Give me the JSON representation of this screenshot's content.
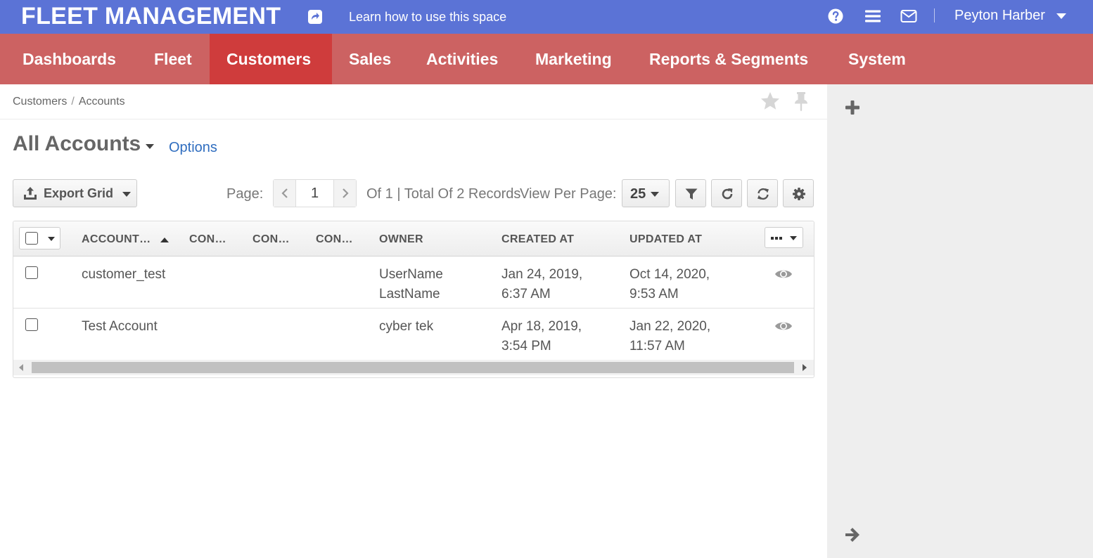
{
  "header": {
    "brand": "FLEET MANAGEMENT",
    "share_icon": "share-square-icon",
    "learn_link": "Learn how to use this space",
    "help_icon": "question-circle-icon",
    "menu_icon": "bars-icon",
    "mail_icon": "envelope-icon",
    "user_name": "Peyton Harber",
    "bar_color": "#5b73d6"
  },
  "nav": {
    "bar_color": "#cc6262",
    "active_color": "#cf3c3c",
    "items": [
      {
        "label": "Dashboards",
        "active": false
      },
      {
        "label": "Fleet",
        "active": false
      },
      {
        "label": "Customers",
        "active": true
      },
      {
        "label": "Sales",
        "active": false
      },
      {
        "label": "Activities",
        "active": false
      },
      {
        "label": "Marketing",
        "active": false
      },
      {
        "label": "Reports & Segments",
        "active": false
      },
      {
        "label": "System",
        "active": false
      }
    ]
  },
  "breadcrumb": {
    "items": [
      "Customers",
      "Accounts"
    ],
    "separator": "/"
  },
  "page": {
    "title": "All Accounts",
    "options_link": "Options"
  },
  "toolbar": {
    "export_label": "Export Grid",
    "page_label": "Page:",
    "current_page": "1",
    "of_text": "Of 1 | Total Of 2 Records",
    "per_page_label": "View Per Page:",
    "per_page_value": "25",
    "buttons": [
      "filter-icon",
      "refresh-icon",
      "reset-sync-icon",
      "gear-icon"
    ]
  },
  "grid": {
    "columns": [
      "ACCOUNT…",
      "CON…",
      "CON…",
      "CON…",
      "OWNER",
      "CREATED AT",
      "UPDATED AT"
    ],
    "sorted_column": "ACCOUNT…",
    "sort_direction": "ascending",
    "rows": [
      {
        "account": "customer_test",
        "owner_line1": "UserName",
        "owner_line2": "LastName",
        "created_line1": "Jan 24, 2019,",
        "created_line2": "6:37 AM",
        "updated_line1": "Oct 14, 2020,",
        "updated_line2": "9:53 AM"
      },
      {
        "account": "Test Account",
        "owner_line1": "cyber tek",
        "owner_line2": "",
        "created_line1": "Apr 18, 2019,",
        "created_line2": "3:54 PM",
        "updated_line1": "Jan 22, 2020,",
        "updated_line2": "11:57 AM"
      }
    ]
  },
  "sidebar": {
    "add_icon": "plus-icon",
    "expand_icon": "arrow-right-icon"
  }
}
